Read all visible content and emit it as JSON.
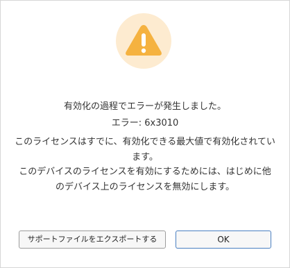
{
  "dialog": {
    "icon": "warning-icon",
    "accent_color": "#f5b240",
    "icon_bg_color": "#fdebd0",
    "title": "有効化の過程でエラーが発生しました。",
    "error_code": "エラー: 6x3010",
    "limit_message": "このライセンスはすでに、有効化できる最大値で有効化されています。",
    "instructions": "このデバイスのライセンスを有効にするためには、はじめに他のデバイス上のライセンスを無効にします。"
  },
  "buttons": {
    "export_label": "サポートファイルをエクスポートする",
    "ok_label": "OK"
  }
}
